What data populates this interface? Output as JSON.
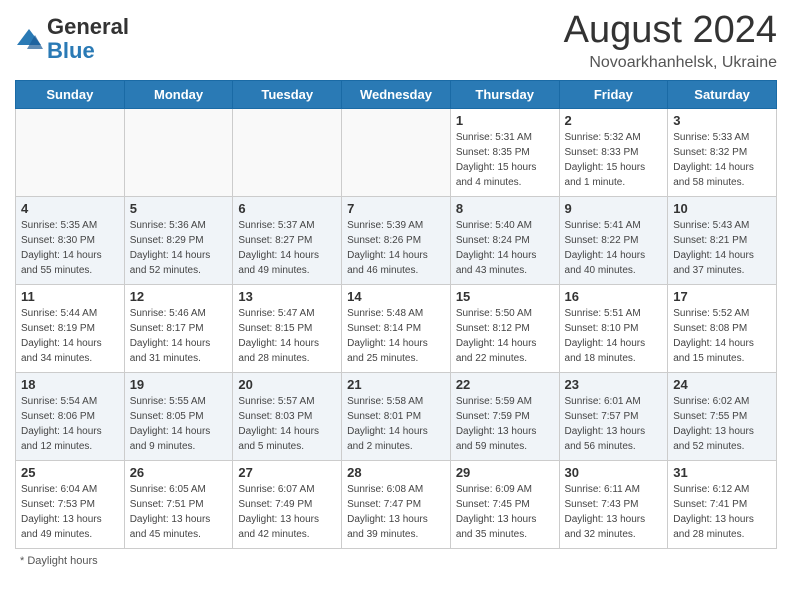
{
  "header": {
    "logo_general": "General",
    "logo_blue": "Blue",
    "title": "August 2024",
    "subtitle": "Novoarkhanhelsk, Ukraine"
  },
  "calendar": {
    "days_of_week": [
      "Sunday",
      "Monday",
      "Tuesday",
      "Wednesday",
      "Thursday",
      "Friday",
      "Saturday"
    ],
    "weeks": [
      [
        {
          "day": "",
          "info": ""
        },
        {
          "day": "",
          "info": ""
        },
        {
          "day": "",
          "info": ""
        },
        {
          "day": "",
          "info": ""
        },
        {
          "day": "1",
          "info": "Sunrise: 5:31 AM\nSunset: 8:35 PM\nDaylight: 15 hours\nand 4 minutes."
        },
        {
          "day": "2",
          "info": "Sunrise: 5:32 AM\nSunset: 8:33 PM\nDaylight: 15 hours\nand 1 minute."
        },
        {
          "day": "3",
          "info": "Sunrise: 5:33 AM\nSunset: 8:32 PM\nDaylight: 14 hours\nand 58 minutes."
        }
      ],
      [
        {
          "day": "4",
          "info": "Sunrise: 5:35 AM\nSunset: 8:30 PM\nDaylight: 14 hours\nand 55 minutes."
        },
        {
          "day": "5",
          "info": "Sunrise: 5:36 AM\nSunset: 8:29 PM\nDaylight: 14 hours\nand 52 minutes."
        },
        {
          "day": "6",
          "info": "Sunrise: 5:37 AM\nSunset: 8:27 PM\nDaylight: 14 hours\nand 49 minutes."
        },
        {
          "day": "7",
          "info": "Sunrise: 5:39 AM\nSunset: 8:26 PM\nDaylight: 14 hours\nand 46 minutes."
        },
        {
          "day": "8",
          "info": "Sunrise: 5:40 AM\nSunset: 8:24 PM\nDaylight: 14 hours\nand 43 minutes."
        },
        {
          "day": "9",
          "info": "Sunrise: 5:41 AM\nSunset: 8:22 PM\nDaylight: 14 hours\nand 40 minutes."
        },
        {
          "day": "10",
          "info": "Sunrise: 5:43 AM\nSunset: 8:21 PM\nDaylight: 14 hours\nand 37 minutes."
        }
      ],
      [
        {
          "day": "11",
          "info": "Sunrise: 5:44 AM\nSunset: 8:19 PM\nDaylight: 14 hours\nand 34 minutes."
        },
        {
          "day": "12",
          "info": "Sunrise: 5:46 AM\nSunset: 8:17 PM\nDaylight: 14 hours\nand 31 minutes."
        },
        {
          "day": "13",
          "info": "Sunrise: 5:47 AM\nSunset: 8:15 PM\nDaylight: 14 hours\nand 28 minutes."
        },
        {
          "day": "14",
          "info": "Sunrise: 5:48 AM\nSunset: 8:14 PM\nDaylight: 14 hours\nand 25 minutes."
        },
        {
          "day": "15",
          "info": "Sunrise: 5:50 AM\nSunset: 8:12 PM\nDaylight: 14 hours\nand 22 minutes."
        },
        {
          "day": "16",
          "info": "Sunrise: 5:51 AM\nSunset: 8:10 PM\nDaylight: 14 hours\nand 18 minutes."
        },
        {
          "day": "17",
          "info": "Sunrise: 5:52 AM\nSunset: 8:08 PM\nDaylight: 14 hours\nand 15 minutes."
        }
      ],
      [
        {
          "day": "18",
          "info": "Sunrise: 5:54 AM\nSunset: 8:06 PM\nDaylight: 14 hours\nand 12 minutes."
        },
        {
          "day": "19",
          "info": "Sunrise: 5:55 AM\nSunset: 8:05 PM\nDaylight: 14 hours\nand 9 minutes."
        },
        {
          "day": "20",
          "info": "Sunrise: 5:57 AM\nSunset: 8:03 PM\nDaylight: 14 hours\nand 5 minutes."
        },
        {
          "day": "21",
          "info": "Sunrise: 5:58 AM\nSunset: 8:01 PM\nDaylight: 14 hours\nand 2 minutes."
        },
        {
          "day": "22",
          "info": "Sunrise: 5:59 AM\nSunset: 7:59 PM\nDaylight: 13 hours\nand 59 minutes."
        },
        {
          "day": "23",
          "info": "Sunrise: 6:01 AM\nSunset: 7:57 PM\nDaylight: 13 hours\nand 56 minutes."
        },
        {
          "day": "24",
          "info": "Sunrise: 6:02 AM\nSunset: 7:55 PM\nDaylight: 13 hours\nand 52 minutes."
        }
      ],
      [
        {
          "day": "25",
          "info": "Sunrise: 6:04 AM\nSunset: 7:53 PM\nDaylight: 13 hours\nand 49 minutes."
        },
        {
          "day": "26",
          "info": "Sunrise: 6:05 AM\nSunset: 7:51 PM\nDaylight: 13 hours\nand 45 minutes."
        },
        {
          "day": "27",
          "info": "Sunrise: 6:07 AM\nSunset: 7:49 PM\nDaylight: 13 hours\nand 42 minutes."
        },
        {
          "day": "28",
          "info": "Sunrise: 6:08 AM\nSunset: 7:47 PM\nDaylight: 13 hours\nand 39 minutes."
        },
        {
          "day": "29",
          "info": "Sunrise: 6:09 AM\nSunset: 7:45 PM\nDaylight: 13 hours\nand 35 minutes."
        },
        {
          "day": "30",
          "info": "Sunrise: 6:11 AM\nSunset: 7:43 PM\nDaylight: 13 hours\nand 32 minutes."
        },
        {
          "day": "31",
          "info": "Sunrise: 6:12 AM\nSunset: 7:41 PM\nDaylight: 13 hours\nand 28 minutes."
        }
      ]
    ]
  },
  "footer": {
    "note": "Daylight hours"
  }
}
